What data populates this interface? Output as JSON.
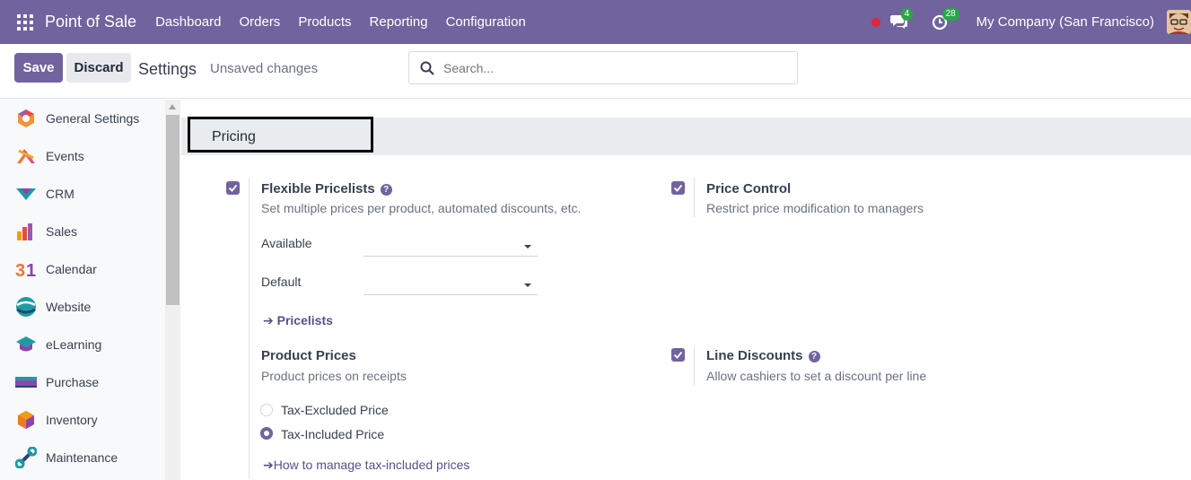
{
  "navbar": {
    "app_title": "Point of Sale",
    "menu": [
      "Dashboard",
      "Orders",
      "Products",
      "Reporting",
      "Configuration"
    ],
    "chat_badge": "4",
    "activity_badge": "28",
    "company": "My Company (San Francisco)"
  },
  "control": {
    "save_label": "Save",
    "discard_label": "Discard",
    "title": "Settings",
    "status": "Unsaved changes",
    "search_placeholder": "Search..."
  },
  "sidebar": {
    "items": [
      {
        "label": "General Settings",
        "icon": "general-settings-icon"
      },
      {
        "label": "Events",
        "icon": "events-icon"
      },
      {
        "label": "CRM",
        "icon": "crm-icon"
      },
      {
        "label": "Sales",
        "icon": "sales-icon"
      },
      {
        "label": "Calendar",
        "icon": "calendar-icon"
      },
      {
        "label": "Website",
        "icon": "website-icon"
      },
      {
        "label": "eLearning",
        "icon": "elearning-icon"
      },
      {
        "label": "Purchase",
        "icon": "purchase-icon"
      },
      {
        "label": "Inventory",
        "icon": "inventory-icon"
      },
      {
        "label": "Maintenance",
        "icon": "maintenance-icon"
      }
    ]
  },
  "pricing": {
    "section_title": "Pricing",
    "flexible": {
      "title": "Flexible Pricelists",
      "desc": "Set multiple prices per product, automated discounts, etc.",
      "checked": true,
      "available_label": "Available",
      "default_label": "Default",
      "link": "Pricelists"
    },
    "price_control": {
      "title": "Price Control",
      "desc": "Restrict price modification to managers",
      "checked": true
    },
    "product_prices": {
      "title": "Product Prices",
      "desc": "Product prices on receipts",
      "options": [
        "Tax-Excluded Price",
        "Tax-Included Price"
      ],
      "selected": "Tax-Included Price",
      "link": "How to manage tax-included prices"
    },
    "line_discounts": {
      "title": "Line Discounts",
      "desc": "Allow cashiers to set a discount per line",
      "checked": true
    }
  },
  "colors": {
    "brand": "#71639e",
    "badge_green": "#28a745",
    "record_red": "#e0263b"
  }
}
